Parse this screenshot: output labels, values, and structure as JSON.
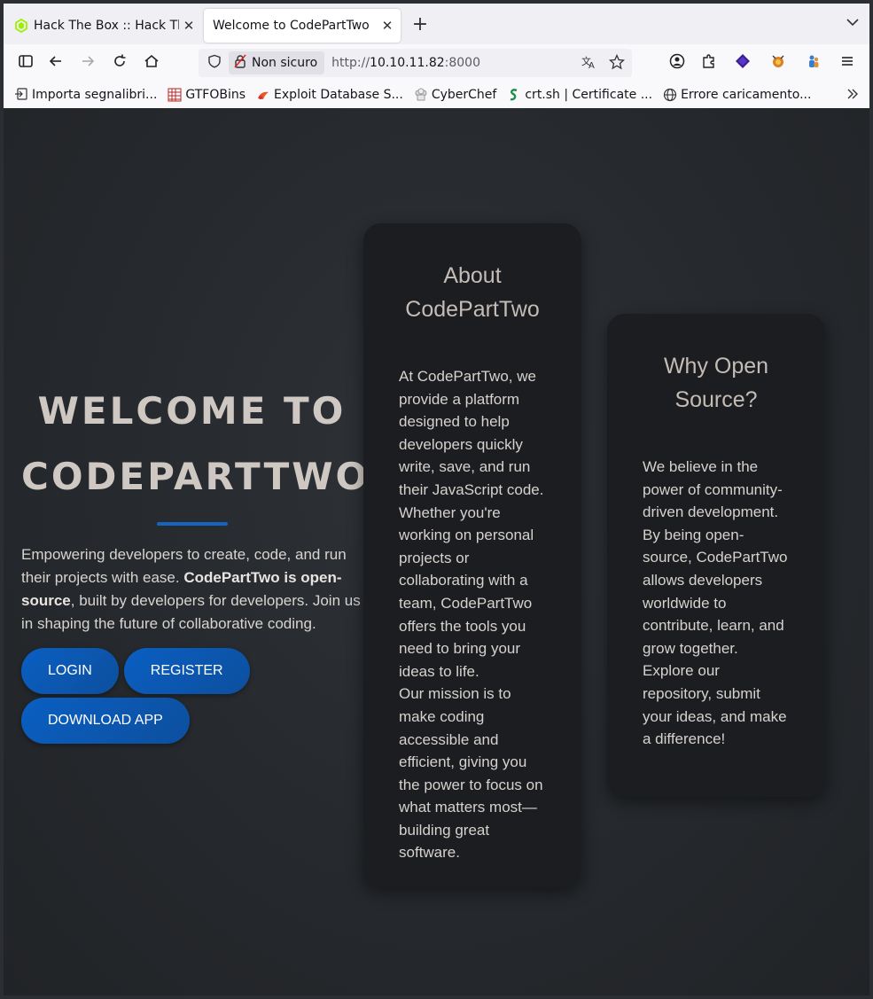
{
  "browser": {
    "tabs": [
      {
        "title": "Hack The Box :: Hack The Box",
        "active": false
      },
      {
        "title": "Welcome to CodePartTwo",
        "active": true
      }
    ],
    "new_tab": "+",
    "security_label": "Non sicuro",
    "url_scheme": "http://",
    "url_host": "10.10.11.82",
    "url_port": ":8000",
    "bookmarks": [
      {
        "label": "Importa segnalibri...",
        "icon": "import-icon"
      },
      {
        "label": "GTFOBins",
        "icon": "gtfobins-icon"
      },
      {
        "label": "Exploit Database S...",
        "icon": "exploit-db-icon"
      },
      {
        "label": "CyberChef",
        "icon": "cyberchef-icon"
      },
      {
        "label": "crt.sh | Certificate ...",
        "icon": "crtsh-icon"
      },
      {
        "label": "Errore caricamento...",
        "icon": "globe-icon"
      }
    ]
  },
  "hero": {
    "title_line1": "WELCOME TO",
    "title_line2": "CODEPARTTWO",
    "intro": "Empowering developers to create, code, and run their projects with ease.",
    "bold": "CodePartTwo is open-source",
    "rest": ", built by developers for developers. Join us in shaping the future of collaborative coding.",
    "buttons": {
      "login": "LOGIN",
      "register": "REGISTER",
      "download": "DOWNLOAD APP"
    }
  },
  "about": {
    "title": "About CodePartTwo",
    "body1": "At CodePartTwo, we provide a platform designed to help developers quickly write, save, and run their JavaScript code. Whether you're working on personal projects or collaborating with a team, CodePartTwo offers the tools you need to bring your ideas to life.",
    "body2": "Our mission is to make coding accessible and efficient, giving you the power to focus on what matters most—building great software."
  },
  "why": {
    "title": "Why Open Source?",
    "body": "We believe in the power of community-driven development. By being open-source, CodePartTwo allows developers worldwide to contribute, learn, and grow together. Explore our repository, submit your ideas, and make a difference!"
  },
  "colors": {
    "accent": "#1565c0",
    "button": "#0a5fc2",
    "card_bg": "#1c1d20",
    "page_bg": "#25282c"
  }
}
